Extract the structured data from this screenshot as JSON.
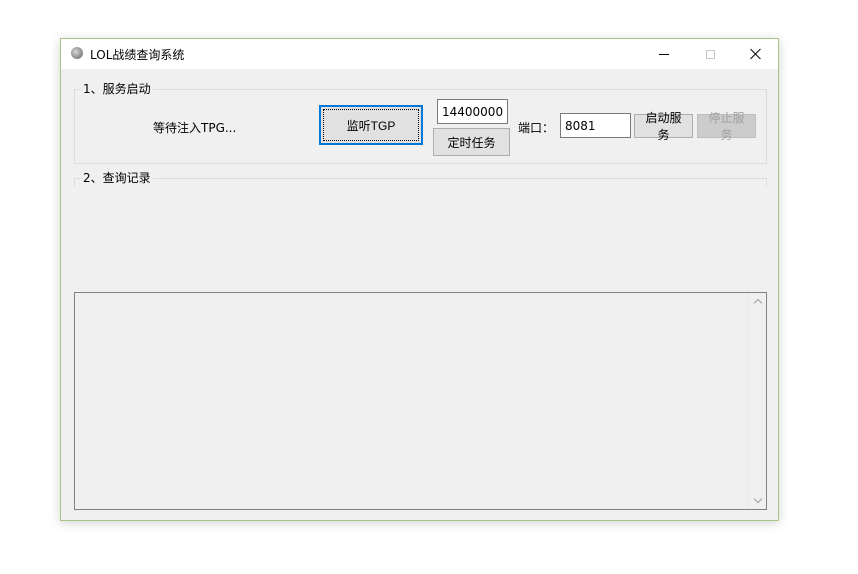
{
  "window": {
    "title": "LOL战绩查询系统",
    "icon": "app-icon",
    "controls": {
      "minimize": "minimize-icon",
      "maximize": "maximize-icon",
      "close": "close-icon"
    }
  },
  "service_group": {
    "legend": "1、服务启动",
    "status_text": "等待注入TPG...",
    "listen_button": "监听TGP",
    "interval_value": "14400000",
    "timer_button": "定时任务",
    "port_label": "端口：",
    "port_value": "8081",
    "start_button": "启动服务",
    "stop_button": "停止服务"
  },
  "query_group": {
    "legend": "2、查询记录"
  },
  "log": {
    "text": ""
  },
  "colors": {
    "window_bg": "#f0f0f0",
    "focus_border": "#0078d7",
    "window_border": "#a9c38a"
  }
}
